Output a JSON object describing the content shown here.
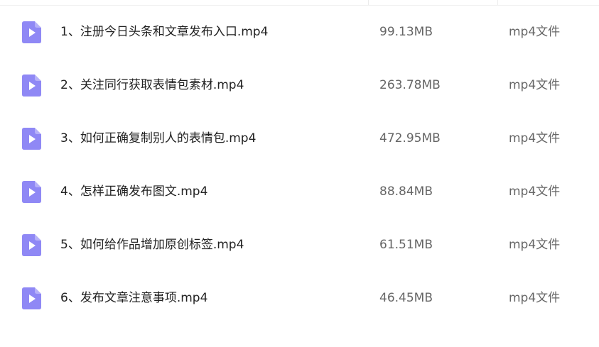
{
  "colors": {
    "icon_background": "#8f88f5",
    "icon_glyph": "#ffffff",
    "name_text": "#222222",
    "meta_text": "#666666"
  },
  "files": [
    {
      "icon": "video-file-icon",
      "name": "1、注册今日头条和文章发布入口.mp4",
      "size": "99.13MB",
      "type": "mp4文件"
    },
    {
      "icon": "video-file-icon",
      "name": "2、关注同行获取表情包素材.mp4",
      "size": "263.78MB",
      "type": "mp4文件"
    },
    {
      "icon": "video-file-icon",
      "name": "3、如何正确复制别人的表情包.mp4",
      "size": "472.95MB",
      "type": "mp4文件"
    },
    {
      "icon": "video-file-icon",
      "name": "4、怎样正确发布图文.mp4",
      "size": "88.84MB",
      "type": "mp4文件"
    },
    {
      "icon": "video-file-icon",
      "name": "5、如何给作品增加原创标签.mp4",
      "size": "61.51MB",
      "type": "mp4文件"
    },
    {
      "icon": "video-file-icon",
      "name": "6、发布文章注意事项.mp4",
      "size": "46.45MB",
      "type": "mp4文件"
    }
  ]
}
